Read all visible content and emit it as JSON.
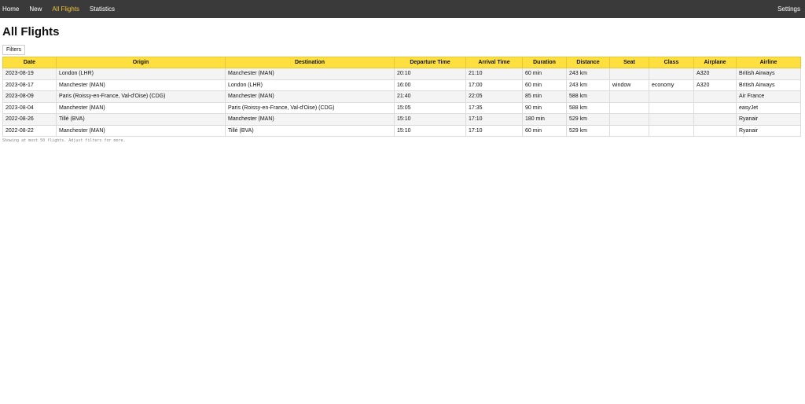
{
  "nav": {
    "items": [
      {
        "label": "Home",
        "active": false
      },
      {
        "label": "New",
        "active": false
      },
      {
        "label": "All Flights",
        "active": true
      },
      {
        "label": "Statistics",
        "active": false
      }
    ],
    "settings_label": "Settings"
  },
  "page": {
    "title": "All Flights",
    "filters_label": "Filters",
    "footnote": "Showing at most 50 flights. Adjust filters for more."
  },
  "colors": {
    "nav_bg": "#3a3a3a",
    "nav_active": "#f2c43d",
    "header_bg": "#fddf3f"
  },
  "table": {
    "columns": [
      "Date",
      "Origin",
      "Destination",
      "Departure Time",
      "Arrival Time",
      "Duration",
      "Distance",
      "Seat",
      "Class",
      "Airplane",
      "Airline"
    ],
    "rows": [
      [
        "2023-08-19",
        "London (LHR)",
        "Manchester (MAN)",
        "20:10",
        "21:10",
        "60 min",
        "243 km",
        "",
        "",
        "A320",
        "British Airways"
      ],
      [
        "2023-08-17",
        "Manchester (MAN)",
        "London (LHR)",
        "16:00",
        "17:00",
        "60 min",
        "243 km",
        "window",
        "economy",
        "A320",
        "British Airways"
      ],
      [
        "2023-08-09",
        "Paris (Roissy-en-France, Val-d'Oise) (CDG)",
        "Manchester (MAN)",
        "21:40",
        "22:05",
        "85 min",
        "588 km",
        "",
        "",
        "",
        "Air France"
      ],
      [
        "2023-08-04",
        "Manchester (MAN)",
        "Paris (Roissy-en-France, Val-d'Oise) (CDG)",
        "15:05",
        "17:35",
        "90 min",
        "588 km",
        "",
        "",
        "",
        "easyJet"
      ],
      [
        "2022-08-26",
        "Tillé (BVA)",
        "Manchester (MAN)",
        "15:10",
        "17:10",
        "180 min",
        "529 km",
        "",
        "",
        "",
        "Ryanair"
      ],
      [
        "2022-08-22",
        "Manchester (MAN)",
        "Tillé (BVA)",
        "15:10",
        "17:10",
        "60 min",
        "529 km",
        "",
        "",
        "",
        "Ryanair"
      ]
    ]
  }
}
